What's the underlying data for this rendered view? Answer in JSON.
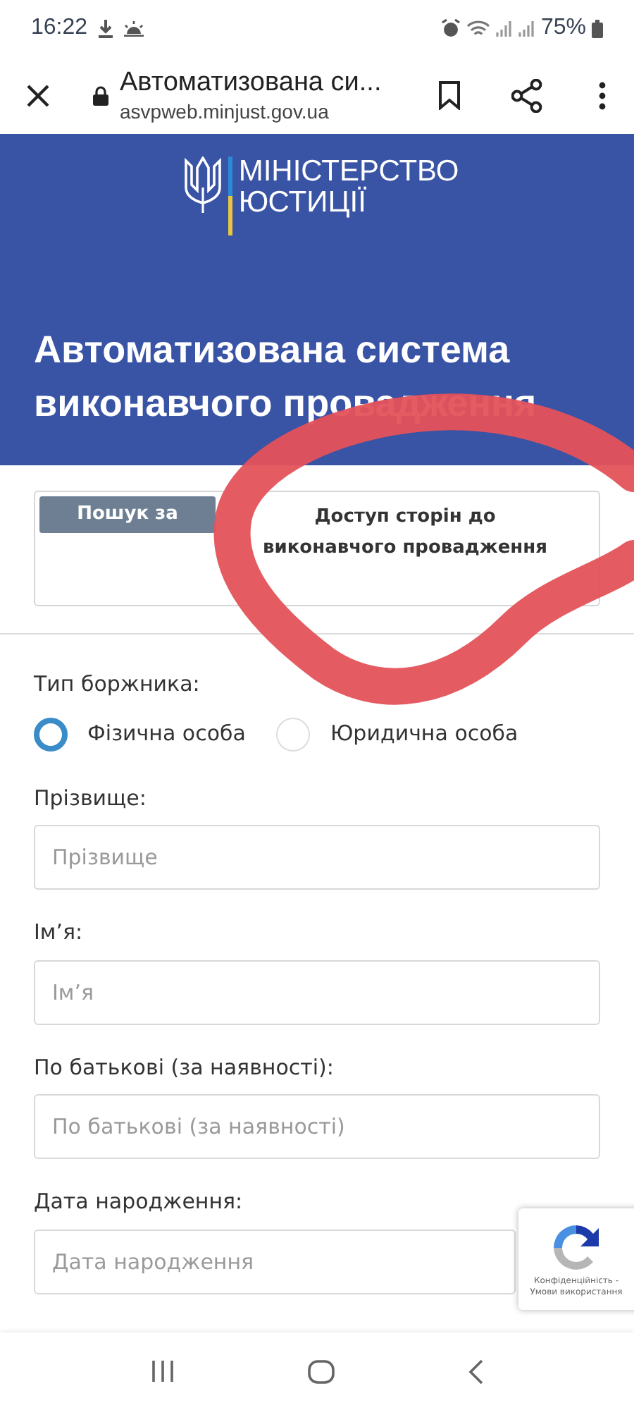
{
  "status_bar": {
    "time": "16:22",
    "battery": "75%"
  },
  "browser": {
    "title": "Автоматизована си...",
    "url": "asvpweb.minjust.gov.ua"
  },
  "header": {
    "logo_lines": [
      "МІНІСТЕРСТВО",
      "ЮСТИЦІЇ"
    ],
    "title": "Автоматизована система виконавчого провадження"
  },
  "tabs": [
    {
      "label": "Пошук за",
      "selected": true
    },
    {
      "label": "Доступ сторін до виконавчого провадження",
      "selected": false
    }
  ],
  "debtor_type": {
    "label": "Тип боржника:",
    "options": [
      {
        "label": "Фізична особа",
        "selected": true
      },
      {
        "label": "Юридична особа",
        "selected": false
      }
    ]
  },
  "fields": [
    {
      "label": "Прізвище:",
      "placeholder": "Прізвище"
    },
    {
      "label": "Ім’я:",
      "placeholder": "Ім’я"
    },
    {
      "label": "По батькові (за наявності):",
      "placeholder": "По батькові (за наявності)"
    },
    {
      "label": "Дата народження:",
      "placeholder": "Дата народження"
    }
  ],
  "recaptcha": {
    "text": "Конфіденційність - Умови використання"
  }
}
